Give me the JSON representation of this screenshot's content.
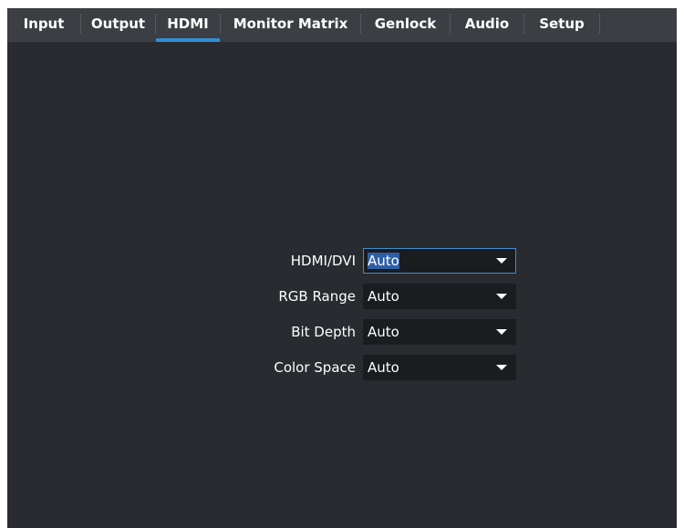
{
  "tabs": [
    {
      "label": "Input"
    },
    {
      "label": "Output"
    },
    {
      "label": "HDMI"
    },
    {
      "label": "Monitor Matrix"
    },
    {
      "label": "Genlock"
    },
    {
      "label": "Audio"
    },
    {
      "label": "Setup"
    }
  ],
  "active_tab": "HDMI",
  "hdmi": {
    "rows": [
      {
        "label": "HDMI/DVI",
        "value": "Auto"
      },
      {
        "label": "RGB Range",
        "value": "Auto"
      },
      {
        "label": "Bit Depth",
        "value": "Auto"
      },
      {
        "label": "Color Space",
        "value": "Auto"
      }
    ]
  },
  "colors": {
    "background": "#282b30",
    "tabbar": "#3b3e43",
    "accent": "#2f8fd8",
    "select_background": "#1a1c1f"
  },
  "icons": {
    "dropdown": "caret-down-icon"
  }
}
